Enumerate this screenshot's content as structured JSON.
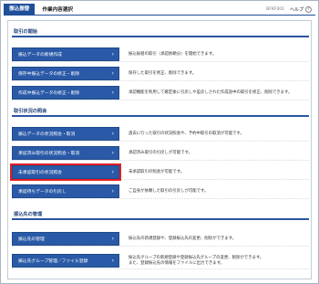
{
  "header": {
    "app_title": "振込振替",
    "page_title": "作業内容選択",
    "screen_code": "BFKF001",
    "help_label": "ヘルプ",
    "help_icon": "?"
  },
  "sections": [
    {
      "title": "取引の開始",
      "rows": [
        {
          "label": "振込データの新規作成",
          "desc": "振込振替の取引（承認依頼分）を開始できます。"
        },
        {
          "label": "保存中振込データの修正・削除",
          "desc": "保存した取引を修正、削除できます。"
        },
        {
          "label": "作成中振込データの修正・削除",
          "desc": "承認機能を利用して確定後に引戻しや差戻しされた作成途中の取引を修正、削除できます。"
        }
      ]
    },
    {
      "title": "取引状況の照会",
      "rows": [
        {
          "label": "振込データの状況照会・取消",
          "desc": "過去に行った取引の状況照会や、予約中取引の取消が可能です。"
        },
        {
          "label": "承認済み取引の状況照会・取消",
          "desc": "承認済み取引の引戻しが可能です。"
        },
        {
          "label": "未承認取引の状況照会",
          "desc": "未承認取引の照会が可能です。",
          "highlighted": true
        },
        {
          "label": "承認待ちデータの引戻し",
          "desc": "ご自身が依頼した取引の引戻しが可能です。"
        }
      ]
    },
    {
      "title": "振込先の管理",
      "rows": [
        {
          "label": "振込先の管理",
          "desc": "振込先の新規登録や、登録振込先の変更、削除ができます。"
        },
        {
          "label": "振込先グループ管理／ファイル登録",
          "desc": "振込先グループの新規登録や登録振込先グループの変更、削除ができます。",
          "desc2": "また、登録振込先の情報をファイルに出力できます。"
        }
      ]
    }
  ],
  "chevron": "›",
  "colors": {
    "accent": "#2a5aa7",
    "highlight": "#e21f26"
  }
}
